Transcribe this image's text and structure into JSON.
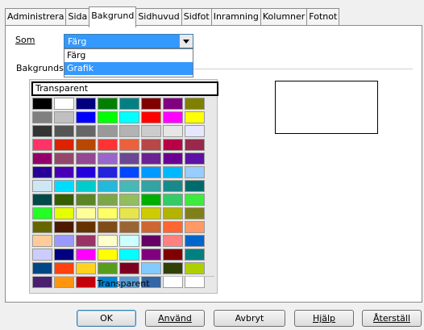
{
  "tabs": [
    "Administrera",
    "Sida",
    "Bakgrund",
    "Sidhuvud",
    "Sidfot",
    "Inramning",
    "Kolumner",
    "Fotnot"
  ],
  "active_tab": "Bakgrund",
  "som_label": "Som",
  "combo_value": "Färg",
  "dropdown_options": [
    "Färg",
    "Grafik"
  ],
  "selected_option": "Grafik",
  "bg_label": "Bakgrunds",
  "transparent_field": "Transparent",
  "transparent_button": "Transparent",
  "palette": [
    "#000000",
    "#ffffff",
    "#000080",
    "#008000",
    "#008080",
    "#800000",
    "#800080",
    "#808000",
    "#808080",
    "#c0c0c0",
    "#0000ff",
    "#00ff00",
    "#00ffff",
    "#ff0000",
    "#ff00ff",
    "#ffff00",
    "#333333",
    "#555555",
    "#666666",
    "#999999",
    "#b3b3b3",
    "#cccccc",
    "#e6e6e6",
    "#e6e6ff",
    "#ff3366",
    "#dc2300",
    "#b84700",
    "#ff3333",
    "#eb613d",
    "#b84747",
    "#b80047",
    "#99284c",
    "#94006b",
    "#94476b",
    "#944794",
    "#9966cc",
    "#6b4794",
    "#6b2394",
    "#6b0094",
    "#5e11a6",
    "#280099",
    "#4700b8",
    "#2300dc",
    "#2323dc",
    "#0047ff",
    "#0099ff",
    "#00b8ff",
    "#99ccff",
    "#cfe7f5",
    "#00dcff",
    "#00cccc",
    "#23b8dc",
    "#47b8b8",
    "#33a3a3",
    "#198a8a",
    "#006b6b",
    "#004a4a",
    "#355e00",
    "#5c8526",
    "#7da647",
    "#94bd5e",
    "#00ae00",
    "#33cc66",
    "#3deb3d",
    "#23ff23",
    "#e6ff00",
    "#ffff99",
    "#ffff66",
    "#e6e64c",
    "#cccc00",
    "#b3b300",
    "#808019",
    "#666600",
    "#4c1900",
    "#663300",
    "#804c19",
    "#996633",
    "#cc6633",
    "#ff6633",
    "#ff9966",
    "#ffcc99",
    "#9999ff",
    "#993366",
    "#ffffcc",
    "#ccffff",
    "#660066",
    "#ff8080",
    "#0066cc",
    "#ccccff",
    "#000080",
    "#ff00ff",
    "#ffff00",
    "#00ffff",
    "#800080",
    "#800000",
    "#008080",
    "#004586",
    "#ff420e",
    "#ffd320",
    "#579d1c",
    "#7e0021",
    "#83caff",
    "#314004",
    "#aecf00",
    "#4b1f6f",
    "#ff950e",
    "#c5000b",
    "#0084d1",
    "#5a9bd4",
    "#3465a4",
    "#ffffff",
    "#ffffff"
  ],
  "buttons": {
    "ok": "OK",
    "apply": "Använd",
    "cancel": "Avbryt",
    "help": "Hjälp",
    "reset": "Återställ"
  }
}
